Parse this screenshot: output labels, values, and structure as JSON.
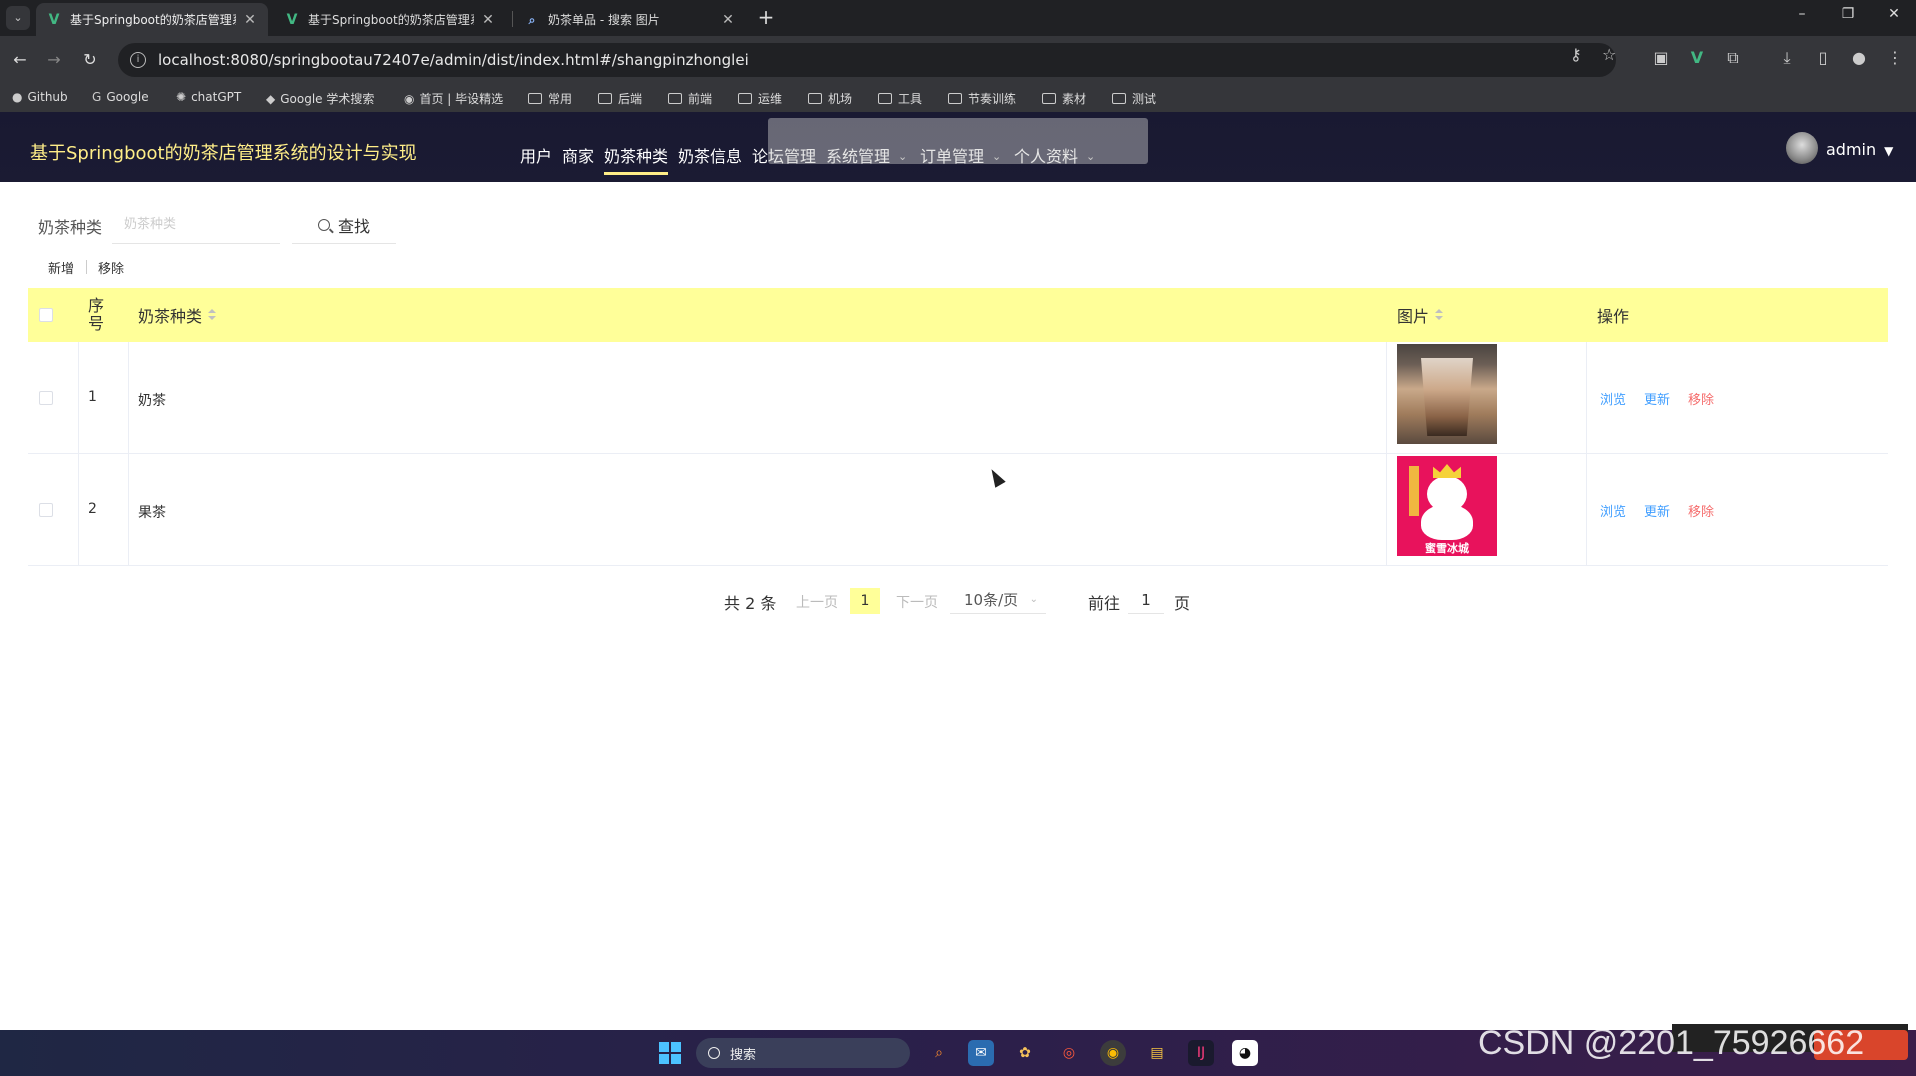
{
  "browser": {
    "tabs": [
      {
        "title": "基于Springboot的奶茶店管理系",
        "active": true
      },
      {
        "title": "基于Springboot的奶茶店管理系",
        "active": false
      },
      {
        "title": "奶茶单品 - 搜索 图片",
        "active": false
      }
    ],
    "url": "localhost:8080/springbootau72407e/admin/dist/index.html#/shangpinzhonglei",
    "bookmarks": [
      {
        "label": "Github",
        "icon": "github-icon"
      },
      {
        "label": "Google",
        "icon": "google-icon"
      },
      {
        "label": "chatGPT",
        "icon": "chatgpt-icon"
      },
      {
        "label": "Google 学术搜索",
        "icon": "scholar-icon"
      },
      {
        "label": "首页 | 毕设精选",
        "icon": "site-icon"
      },
      {
        "label": "常用",
        "icon": "folder-icon"
      },
      {
        "label": "后端",
        "icon": "folder-icon"
      },
      {
        "label": "前端",
        "icon": "folder-icon"
      },
      {
        "label": "运维",
        "icon": "folder-icon"
      },
      {
        "label": "机场",
        "icon": "folder-icon"
      },
      {
        "label": "工具",
        "icon": "folder-icon"
      },
      {
        "label": "节奏训练",
        "icon": "folder-icon"
      },
      {
        "label": "素材",
        "icon": "folder-icon"
      },
      {
        "label": "测试",
        "icon": "folder-icon"
      }
    ]
  },
  "app": {
    "title": "基于Springboot的奶茶店管理系统的设计与实现",
    "menu": [
      {
        "label": "用户",
        "active": false,
        "dropdown": false
      },
      {
        "label": "商家",
        "active": false,
        "dropdown": false
      },
      {
        "label": "奶茶种类",
        "active": true,
        "dropdown": false
      },
      {
        "label": "奶茶信息",
        "active": false,
        "dropdown": false
      },
      {
        "label": "论坛管理",
        "active": false,
        "dropdown": false
      },
      {
        "label": "系统管理",
        "active": false,
        "dropdown": true
      },
      {
        "label": "订单管理",
        "active": false,
        "dropdown": true
      },
      {
        "label": "个人资料",
        "active": false,
        "dropdown": true
      }
    ],
    "user": "admin"
  },
  "search": {
    "label": "奶茶种类",
    "placeholder": "奶茶种类",
    "value": "",
    "button": "查找"
  },
  "actions": {
    "add": "新增",
    "remove": "移除"
  },
  "table": {
    "headers": {
      "index": "序号",
      "category": "奶茶种类",
      "image": "图片",
      "ops": "操作"
    },
    "rows": [
      {
        "index": "1",
        "category": "奶茶",
        "image": "milk-tea-photo",
        "ops": {
          "view": "浏览",
          "edit": "更新",
          "remove": "移除"
        }
      },
      {
        "index": "2",
        "category": "果茶",
        "image": "mixue-snowman-photo",
        "ops": {
          "view": "浏览",
          "edit": "更新",
          "remove": "移除"
        }
      }
    ]
  },
  "pagination": {
    "total": "共 2 条",
    "prev": "上一页",
    "current": "1",
    "next": "下一页",
    "size": "10条/页",
    "goto_prefix": "前往",
    "goto_value": "1",
    "goto_suffix": "页"
  },
  "taskbar": {
    "search_placeholder": "搜索",
    "watermark": "CSDN @2201_75926662"
  },
  "thumb2_brand": "蜜雪冰城",
  "colors": {
    "header_bg": "#1b1b33",
    "accent": "#ffee88",
    "table_header_bg": "#ffff99",
    "link_blue": "#409eff",
    "danger_red": "#f56c6c"
  }
}
